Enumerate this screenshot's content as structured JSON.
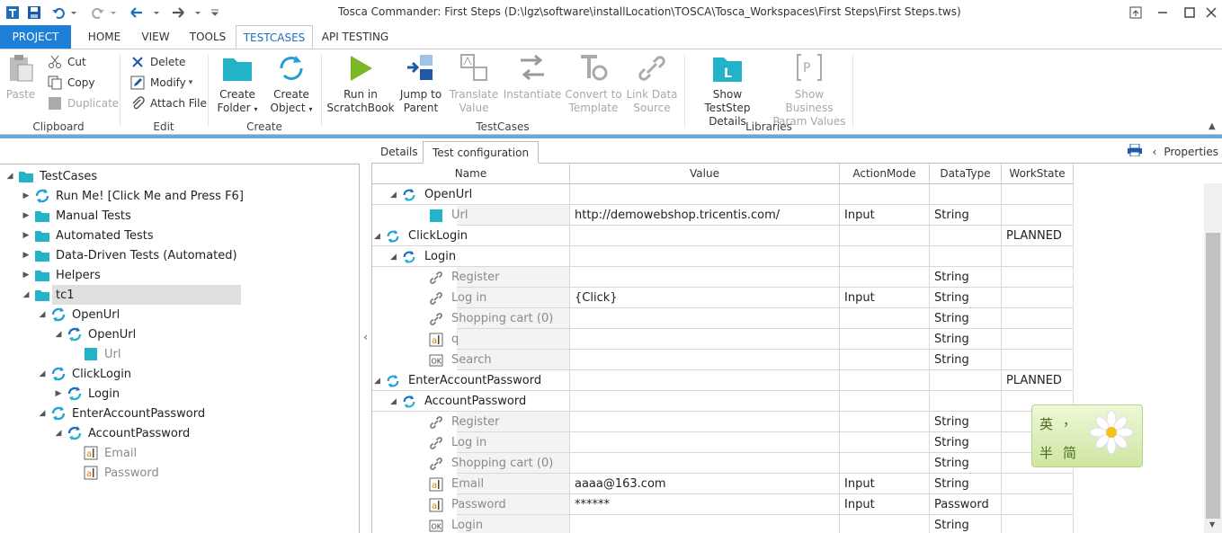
{
  "window": {
    "title": "Tosca Commander: First Steps (D:\\lgz\\software\\installLocation\\TOSCA\\Tosca_Workspaces\\First Steps\\First Steps.tws)"
  },
  "menu_tabs": [
    "PROJECT",
    "HOME",
    "VIEW",
    "TOOLS",
    "TESTCASES",
    "API TESTING"
  ],
  "ribbon": {
    "clipboard": {
      "paste": "Paste",
      "cut": "Cut",
      "copy": "Copy",
      "duplicate": "Duplicate",
      "group": "Clipboard"
    },
    "edit": {
      "delete": "Delete",
      "modify": "Modify",
      "attach": "Attach File",
      "group": "Edit"
    },
    "create": {
      "folder_1": "Create",
      "folder_2": "Folder",
      "object_1": "Create",
      "object_2": "Object",
      "group": "Create"
    },
    "testcases": {
      "run_1": "Run in",
      "run_2": "ScratchBook",
      "jump_1": "Jump to",
      "jump_2": "Parent",
      "translate_1": "Translate",
      "translate_2": "Value",
      "instantiate": "Instantiate",
      "convert_1": "Convert to",
      "convert_2": "Template",
      "link_1": "Link Data",
      "link_2": "Source",
      "group": "TestCases"
    },
    "libraries": {
      "show_ts_1": "Show TestStep",
      "show_ts_2": "Details",
      "show_bp_1": "Show Business",
      "show_bp_2": "Param Values",
      "group": "Libraries"
    }
  },
  "colors": {
    "accent": "#1e7fd6",
    "teal": "#22b3c9",
    "run_green": "#7ab828"
  },
  "tree": [
    {
      "label": "TestCases",
      "icon": "folder-icon"
    },
    {
      "label": "Run Me! [Click Me and Press F6]",
      "icon": "testcase-icon"
    },
    {
      "label": "Manual Tests",
      "icon": "folder-icon"
    },
    {
      "label": "Automated Tests",
      "icon": "folder-icon"
    },
    {
      "label": "Data-Driven Tests (Automated)",
      "icon": "folder-icon"
    },
    {
      "label": "Helpers",
      "icon": "folder-icon"
    },
    {
      "label": "tc1",
      "icon": "folder-icon"
    },
    {
      "label": "OpenUrl",
      "icon": "teststep-folder-icon"
    },
    {
      "label": "OpenUrl",
      "icon": "teststep-icon"
    },
    {
      "label": "Url",
      "icon": "value-icon"
    },
    {
      "label": "ClickLogin",
      "icon": "teststep-folder-icon"
    },
    {
      "label": "Login",
      "icon": "teststep-icon"
    },
    {
      "label": "EnterAccountPassword",
      "icon": "teststep-folder-icon"
    },
    {
      "label": "AccountPassword",
      "icon": "teststep-icon"
    },
    {
      "label": "Email",
      "icon": "textbox-icon"
    },
    {
      "label": "Password",
      "icon": "textbox-icon"
    }
  ],
  "right_tabs": {
    "details": "Details",
    "test_config": "Test configuration",
    "properties": "Properties"
  },
  "grid": {
    "columns": [
      "Name",
      "Value",
      "ActionMode",
      "DataType",
      "WorkState"
    ],
    "rows": [
      {
        "name": "OpenUrl",
        "value": "",
        "action": "",
        "datatype": "",
        "workstate": "",
        "icon": "teststep-icon"
      },
      {
        "name": "Url",
        "value": "http://demowebshop.tricentis.com/",
        "action": "Input",
        "datatype": "String",
        "workstate": "",
        "icon": "value-icon"
      },
      {
        "name": "ClickLogin",
        "value": "",
        "action": "",
        "datatype": "",
        "workstate": "PLANNED",
        "icon": "teststep-folder-icon"
      },
      {
        "name": "Login",
        "value": "",
        "action": "",
        "datatype": "",
        "workstate": "",
        "icon": "teststep-icon"
      },
      {
        "name": "Register",
        "value": "",
        "action": "",
        "datatype": "String",
        "workstate": "",
        "icon": "link-icon"
      },
      {
        "name": "Log in",
        "value": "{Click}",
        "action": "Input",
        "datatype": "String",
        "workstate": "",
        "icon": "link-icon"
      },
      {
        "name": "Shopping cart (0)",
        "value": "",
        "action": "",
        "datatype": "String",
        "workstate": "",
        "icon": "link-icon"
      },
      {
        "name": "q",
        "value": "",
        "action": "",
        "datatype": "String",
        "workstate": "",
        "icon": "textbox-icon"
      },
      {
        "name": "Search",
        "value": "",
        "action": "",
        "datatype": "String",
        "workstate": "",
        "icon": "button-icon"
      },
      {
        "name": "EnterAccountPassword",
        "value": "",
        "action": "",
        "datatype": "",
        "workstate": "PLANNED",
        "icon": "teststep-folder-icon"
      },
      {
        "name": "AccountPassword",
        "value": "",
        "action": "",
        "datatype": "",
        "workstate": "",
        "icon": "teststep-icon"
      },
      {
        "name": "Register",
        "value": "",
        "action": "",
        "datatype": "String",
        "workstate": "",
        "icon": "link-icon"
      },
      {
        "name": "Log in",
        "value": "",
        "action": "",
        "datatype": "String",
        "workstate": "",
        "icon": "link-icon"
      },
      {
        "name": "Shopping cart (0)",
        "value": "",
        "action": "",
        "datatype": "String",
        "workstate": "",
        "icon": "link-icon"
      },
      {
        "name": "Email",
        "value": "aaaa@163.com",
        "action": "Input",
        "datatype": "String",
        "workstate": "",
        "icon": "textbox-icon"
      },
      {
        "name": "Password",
        "value": "******",
        "action": "Input",
        "datatype": "Password",
        "workstate": "",
        "icon": "textbox-icon"
      },
      {
        "name": "Login",
        "value": "",
        "action": "",
        "datatype": "String",
        "workstate": "",
        "icon": "button-icon"
      }
    ]
  },
  "ime": {
    "top_left": "英",
    "top_right": "，",
    "bottom_left": "半",
    "bottom_right": "简"
  }
}
